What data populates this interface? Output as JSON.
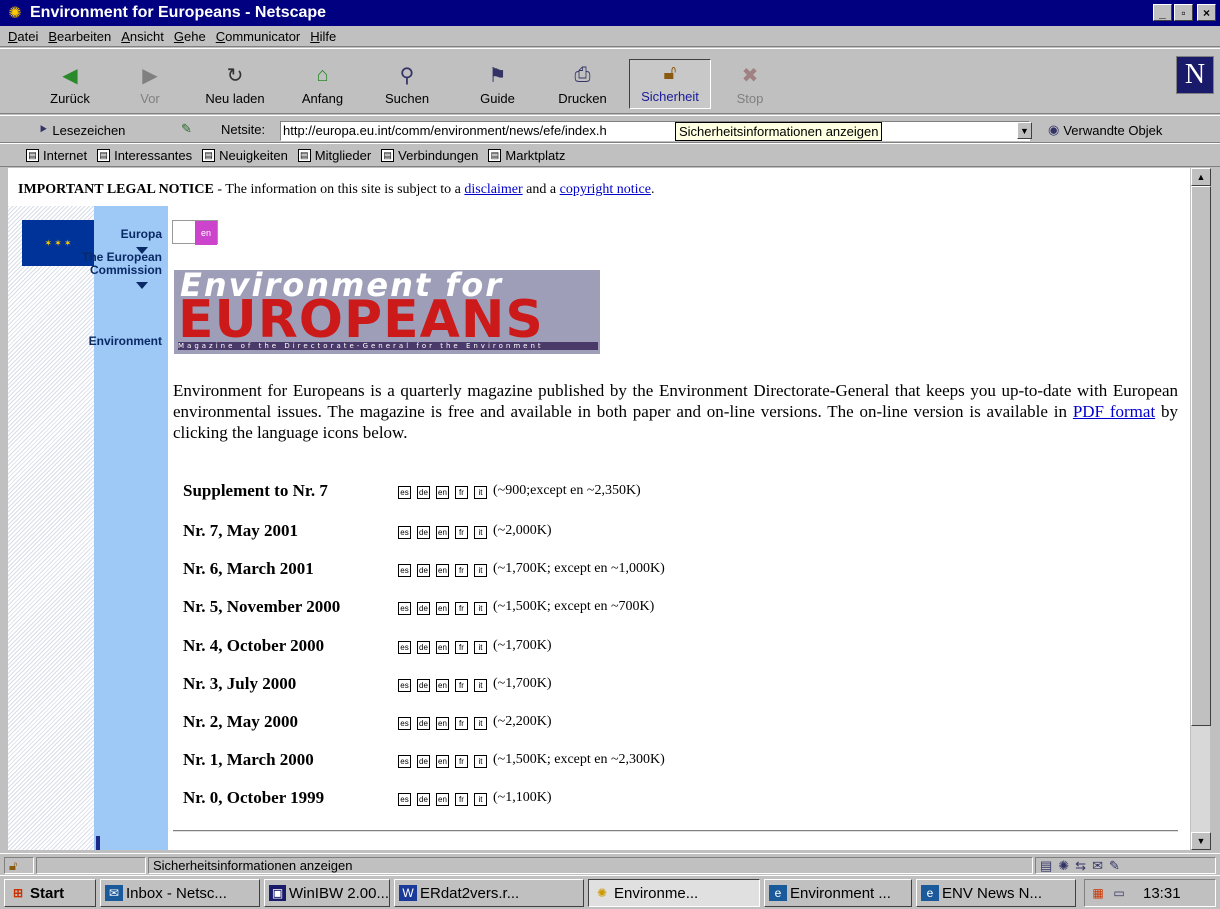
{
  "window": {
    "title": "Environment for Europeans - Netscape"
  },
  "menu": [
    "Datei",
    "Bearbeiten",
    "Ansicht",
    "Gehe",
    "Communicator",
    "Hilfe"
  ],
  "nav": {
    "back": "Zurück",
    "forward": "Vor",
    "reload": "Neu laden",
    "home": "Anfang",
    "search": "Suchen",
    "guide": "Guide",
    "print": "Drucken",
    "security": "Sicherheit",
    "stop": "Stop"
  },
  "location": {
    "bookmarks": "Lesezeichen",
    "label": "Netsite:",
    "url": "http://europa.eu.int/comm/environment/news/efe/index.h",
    "tooltip": "Sicherheitsinformationen anzeigen",
    "related": "Verwandte Objek"
  },
  "personal": [
    "Internet",
    "Interessantes",
    "Neuigkeiten",
    "Mitglieder",
    "Verbindungen",
    "Marktplatz"
  ],
  "page": {
    "notice_bold": "IMPORTANT LEGAL NOTICE",
    "notice_text": " - The information on this site is subject to a ",
    "disclaimer": "disclaimer",
    "and": " and a ",
    "copyright": "copyright notice",
    "dot": ".",
    "side": {
      "europa": "Europa",
      "commission": "The European Commission",
      "environment": "Environment"
    },
    "lang_badge": "en",
    "banner_top": "Environment for",
    "banner_main": "EUROPEANS",
    "banner_sub": "Magazine of the Directorate-General for the Environment",
    "intro_1": "Environment for Europeans is a quarterly magazine published by the Environment Directorate-General that keeps you up-to-date with European environmental issues. The magazine is free and available in both paper and on-line versions. The on-line version is available in ",
    "pdf_link": "PDF format",
    "intro_2": " by clicking the language icons below.",
    "langs": [
      "es",
      "de",
      "en",
      "fr",
      "it"
    ],
    "issues": [
      {
        "name": "Supplement to Nr. 7",
        "size": "(~900;except en ~2,350K)"
      },
      {
        "name": "Nr. 7, May 2001",
        "size": "(~2,000K)"
      },
      {
        "name": "Nr. 6, March 2001",
        "size": "(~1,700K; except en ~1,000K)"
      },
      {
        "name": "Nr. 5, November 2000",
        "size": "(~1,500K; except en ~700K)"
      },
      {
        "name": "Nr. 4, October 2000",
        "size": "(~1,700K)"
      },
      {
        "name": "Nr. 3, July 2000",
        "size": "(~1,700K)"
      },
      {
        "name": "Nr. 2, May 2000",
        "size": "(~2,200K)"
      },
      {
        "name": "Nr. 1, March 2000",
        "size": "(~1,500K; except en ~2,300K)"
      },
      {
        "name": "Nr. 0, October 1999",
        "size": "(~1,100K)"
      }
    ]
  },
  "status": {
    "text": "Sicherheitsinformationen anzeigen"
  },
  "taskbar": {
    "start": "Start",
    "items": [
      "Inbox - Netsc...",
      "WinIBW 2.00...",
      "ERdat2vers.r...",
      "Environme...",
      "Environment ...",
      "ENV News N..."
    ],
    "clock": "13:31"
  }
}
